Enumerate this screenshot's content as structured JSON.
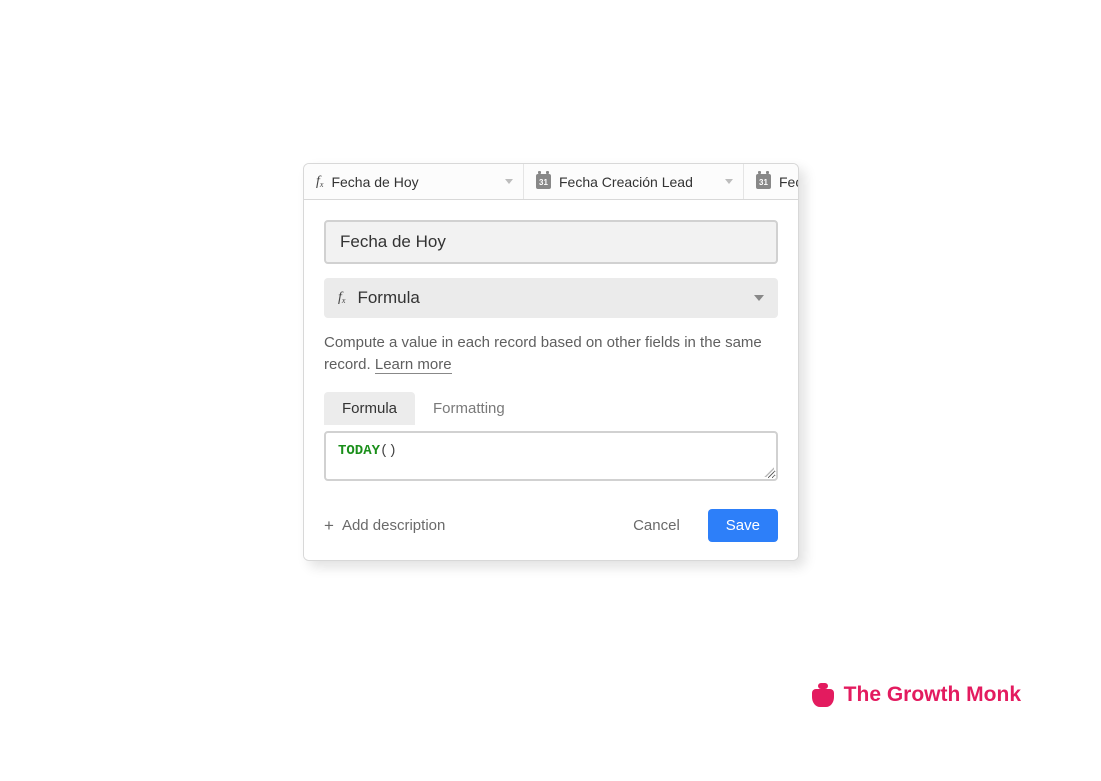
{
  "columns": [
    {
      "icon": "fx",
      "label": "Fecha de Hoy"
    },
    {
      "icon": "cal",
      "label": "Fecha Creación Lead",
      "iconText": "31"
    },
    {
      "icon": "cal",
      "label": "Fec",
      "iconText": "31"
    }
  ],
  "popover": {
    "field_name": "Fecha de Hoy",
    "field_type": "Formula",
    "help_text": "Compute a value in each record based on other fields in the same record. ",
    "learn_more": "Learn more",
    "tabs": {
      "formula": "Formula",
      "formatting": "Formatting"
    },
    "formula": {
      "fn": "TODAY",
      "args": "()"
    },
    "add_description": "Add description",
    "cancel": "Cancel",
    "save": "Save"
  },
  "brand": {
    "name": "The Growth Monk"
  }
}
